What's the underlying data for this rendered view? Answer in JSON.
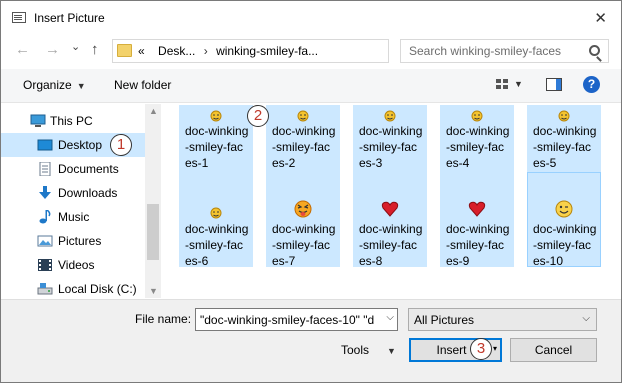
{
  "title": "Insert Picture",
  "nav": {
    "back": "←",
    "forward": "→",
    "dropdown": "⌄",
    "up": "↑",
    "breadcrumb_prefix": "«",
    "breadcrumb": [
      "Desk...",
      "winking-smiley-fa..."
    ],
    "breadcrumb_sep": "›",
    "search_placeholder": "Search winking-smiley-faces"
  },
  "toolbar": {
    "organize": "Organize",
    "new_folder": "New folder"
  },
  "sidebar": [
    {
      "label": "This PC",
      "icon": "computer-icon"
    },
    {
      "label": "Desktop",
      "icon": "desktop-icon",
      "selected": true
    },
    {
      "label": "Documents",
      "icon": "documents-icon"
    },
    {
      "label": "Downloads",
      "icon": "downloads-icon"
    },
    {
      "label": "Music",
      "icon": "music-icon"
    },
    {
      "label": "Pictures",
      "icon": "pictures-icon"
    },
    {
      "label": "Videos",
      "icon": "videos-icon"
    },
    {
      "label": "Local Disk (C:)",
      "icon": "disk-icon"
    }
  ],
  "files": [
    {
      "label": "doc-winking-smiley-faces-1",
      "icon": "winking-smiley-small-icon"
    },
    {
      "label": "doc-winking-smiley-faces-2",
      "icon": "winking-smiley-small-icon"
    },
    {
      "label": "doc-winking-smiley-faces-3",
      "icon": "winking-smiley-small-icon"
    },
    {
      "label": "doc-winking-smiley-faces-4",
      "icon": "winking-smiley-small-icon"
    },
    {
      "label": "doc-winking-smiley-faces-5",
      "icon": "winking-smiley-small-icon"
    },
    {
      "label": "doc-winking-smiley-faces-6",
      "icon": "winking-smiley-small-icon"
    },
    {
      "label": "doc-winking-smiley-faces-7",
      "icon": "tongue-out-smiley-icon"
    },
    {
      "label": "doc-winking-smiley-faces-8",
      "icon": "red-heart-icon"
    },
    {
      "label": "doc-winking-smiley-faces-9",
      "icon": "red-heart-icon"
    },
    {
      "label": "doc-winking-smiley-faces-10",
      "icon": "winking-smiley-icon"
    }
  ],
  "file_name_label": "File name:",
  "file_name_value": "\"doc-winking-smiley-faces-10\" \"d",
  "file_type": "All Pictures",
  "tools": "Tools",
  "insert": "Insert",
  "cancel": "Cancel",
  "steps": [
    "1",
    "2",
    "3"
  ],
  "colors": {
    "selection": "#cce8ff",
    "accent": "#0078d7",
    "step_number": "#c0392b"
  }
}
